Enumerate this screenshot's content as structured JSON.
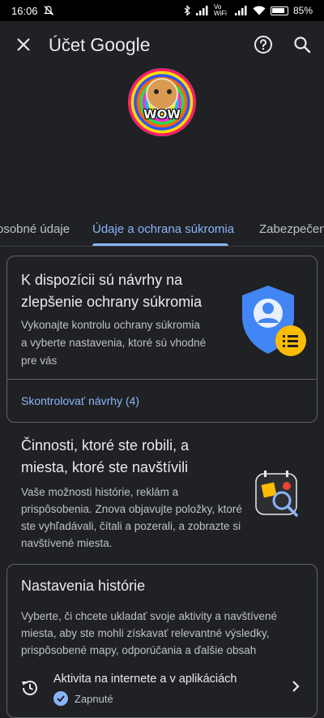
{
  "status_bar": {
    "time": "16:06",
    "network_label": "Vo WiFi",
    "battery": "85%"
  },
  "app_bar": {
    "title_prefix": "Účet",
    "title_brand": "Google",
    "close_icon": "close-icon",
    "help_icon": "help-icon",
    "search_icon": "search-icon"
  },
  "avatar": {
    "caption": "WOW"
  },
  "tabs": [
    {
      "label": "osobné údaje"
    },
    {
      "label": "Údaje a ochrana súkromia",
      "selected": true
    },
    {
      "label": "Zabezpečen"
    }
  ],
  "privacy_card": {
    "title": "K dispozícii sú návrhy na zlepšenie ochrany súkromia",
    "description": "Vykonajte kontrolu ochrany súkromia a vyberte nastavenia, ktoré sú vhodné pre vás",
    "link": "Skontrolovať návrhy (4)",
    "accent_blue": "#4285f4",
    "accent_yellow": "#fbbc04"
  },
  "activity_section": {
    "title": "Činnosti, ktoré ste robili, a miesta, ktoré ste navštívili",
    "description": "Vaše možnosti histórie, reklám a prispôsobenia. Znova objavujte položky, ktoré ste vyhľadávali, čítali a pozerali, a zobrazte si navštívené miesta."
  },
  "history_card": {
    "title": "Nastavenia histórie",
    "description": "Vyberte, či chcete ukladať svoje aktivity a navštívené miesta, aby ste mohli získavať relevantné výsledky, prispôsobené mapy, odporúčania a ďalšie obsah",
    "row": {
      "label": "Aktivita na internete a v aplikáciách",
      "status": "Zapnuté"
    }
  }
}
